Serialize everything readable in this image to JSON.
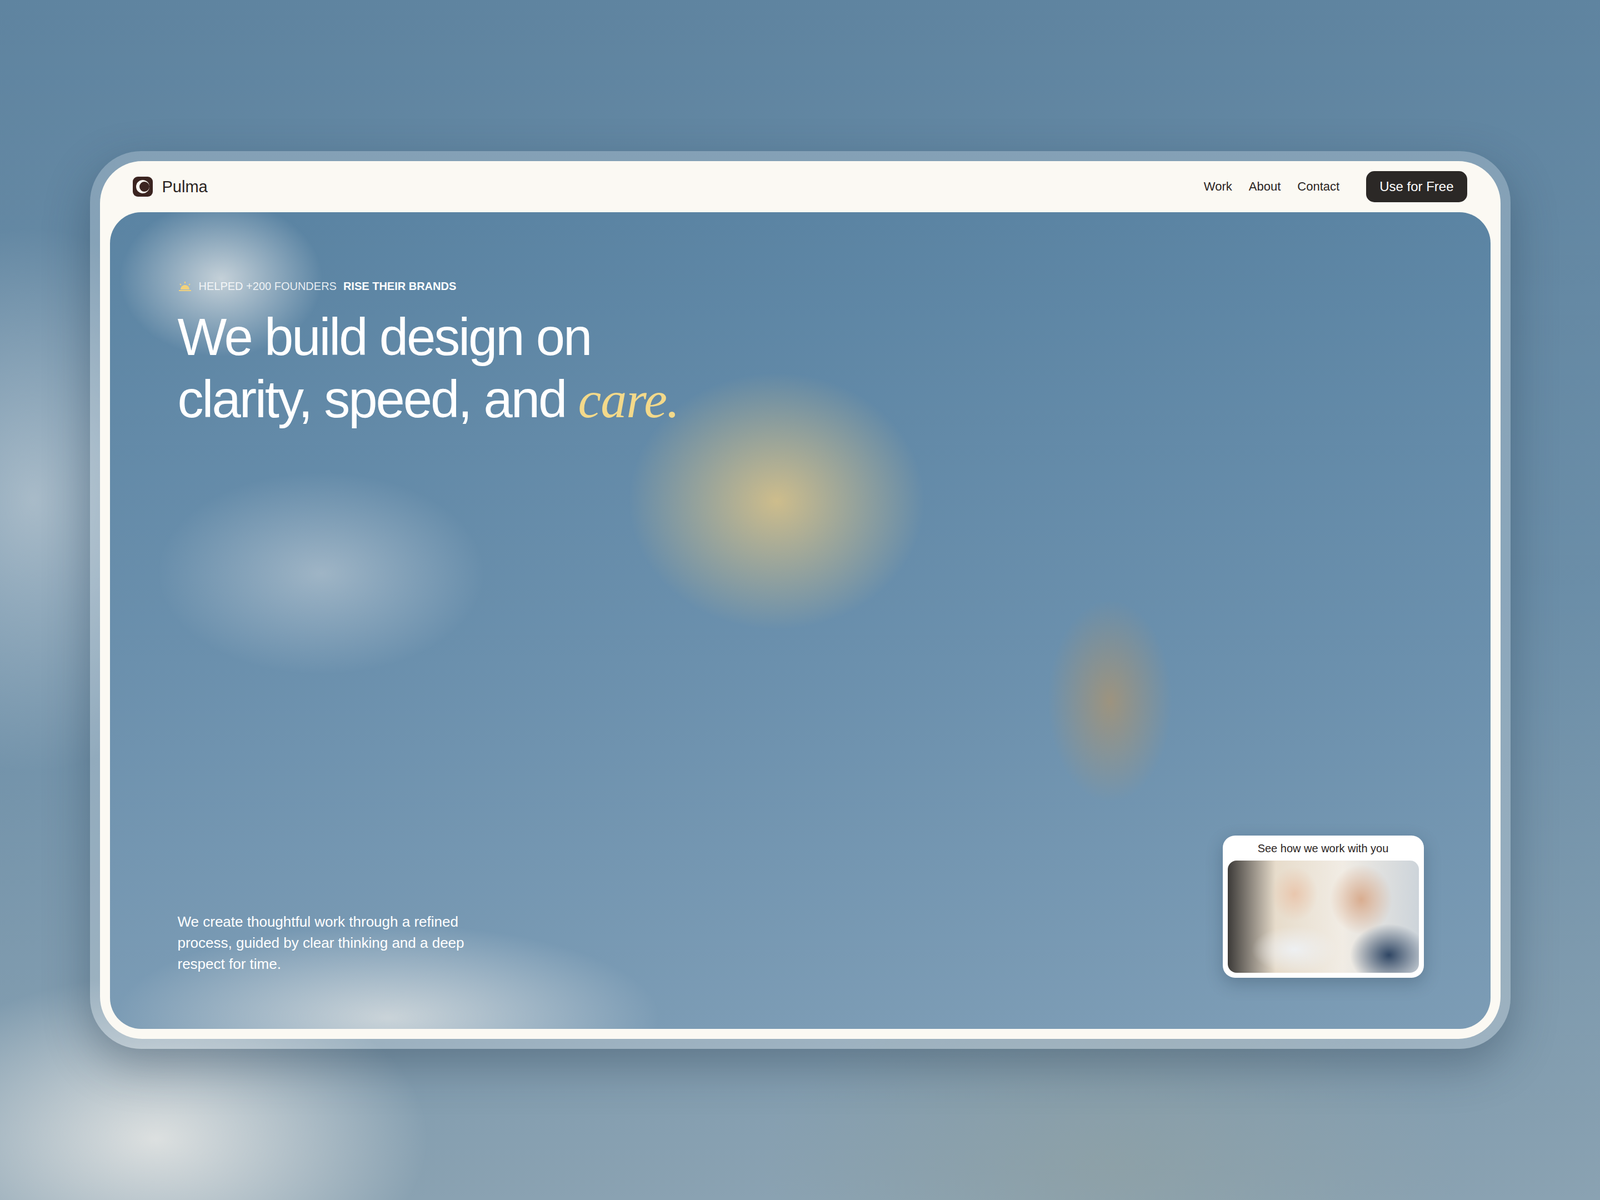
{
  "brand": {
    "name": "Pulma"
  },
  "nav": {
    "links": [
      "Work",
      "About",
      "Contact"
    ],
    "cta": "Use for Free"
  },
  "hero": {
    "badge": {
      "prefix": "HELPED +200 FOUNDERS",
      "emphasis": "RISE THEIR BRANDS"
    },
    "headline": {
      "lines": [
        "We build design on",
        "clarity, speed, and"
      ],
      "accent": "care."
    },
    "description": "We create thoughtful work through a refined process, guided by clear thinking and a deep respect for time."
  },
  "video_card": {
    "title": "See how we work with you"
  }
}
